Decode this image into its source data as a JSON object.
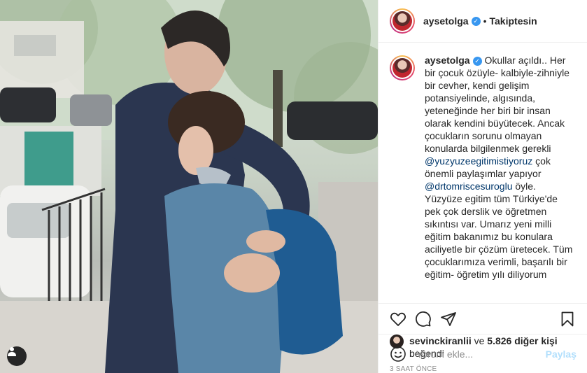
{
  "post": {
    "username": "aysetolga",
    "follow_status": "Takiptesin",
    "separator": "•",
    "verified_symbol": "✓"
  },
  "caption": {
    "part1": " Okullar açıldı.. Her bir çocuk özüyle- kalbiyle-zihniyle bir cevher, kendi gelişim potansiyelinde, algısında, yeteneğinde her biri bir insan olarak kendini büyütecek. Ancak çocukların sorunu olmayan konularda bilgilenmek gerekli ",
    "mention1": "@yuzyuzeegitimistiyoruz",
    "part2": " çok önemli paylaşımlar yapıyor ",
    "mention2": "@drtomriscesuroglu",
    "part3": " öyle. Yüzyüze egitim tüm Türkiye'de pek çok derslik ve öğretmen sıkıntısı var. Umarız yeni milli eğitim bakanımız bu konulara aciliyetle bir çözüm üretecek. Tüm çocuklarımıza verimli, başarılı bir eğitim- öğretim yılı diliyorum"
  },
  "likes": {
    "first_user": "sevinckiranlii",
    "connector": " ve ",
    "count_text": "5.826 diğer kişi",
    "suffix": " beğendi"
  },
  "time_ago": "3 SAAT ÖNCE",
  "comment": {
    "placeholder": "Yorum ekle...",
    "post_label": "Paylaş"
  },
  "icons": {
    "like": "heart-icon",
    "comment": "comment-icon",
    "share": "send-icon",
    "save": "bookmark-icon",
    "emoji": "emoji-icon",
    "tags": "user-tag-icon"
  },
  "colors": {
    "text": "#262626",
    "muted": "#8e8e8e",
    "link": "#00376b",
    "verified": "#3897f0",
    "post_button_disabled": "#b2dffc"
  }
}
